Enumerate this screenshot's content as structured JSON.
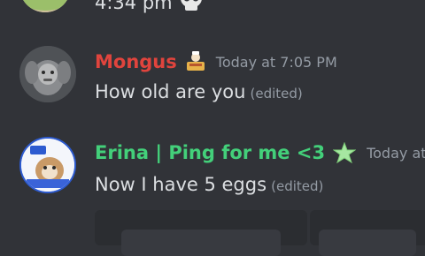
{
  "messages": [
    {
      "timestamp_tail": "4:34 pm",
      "emoji": "skull-emoji"
    },
    {
      "author": "Mongus",
      "author_color": "#e0443d",
      "role_icon": "cooking-icon",
      "timestamp": "Today at 7:05 PM",
      "text": "How old are you",
      "edited": "(edited)"
    },
    {
      "author": "Еrina | Ping for me <3",
      "author_color": "#43d07a",
      "role_icon": "star-icon",
      "timestamp": "Today at",
      "text": "Now I have 5 eggs",
      "edited": "(edited)"
    }
  ]
}
